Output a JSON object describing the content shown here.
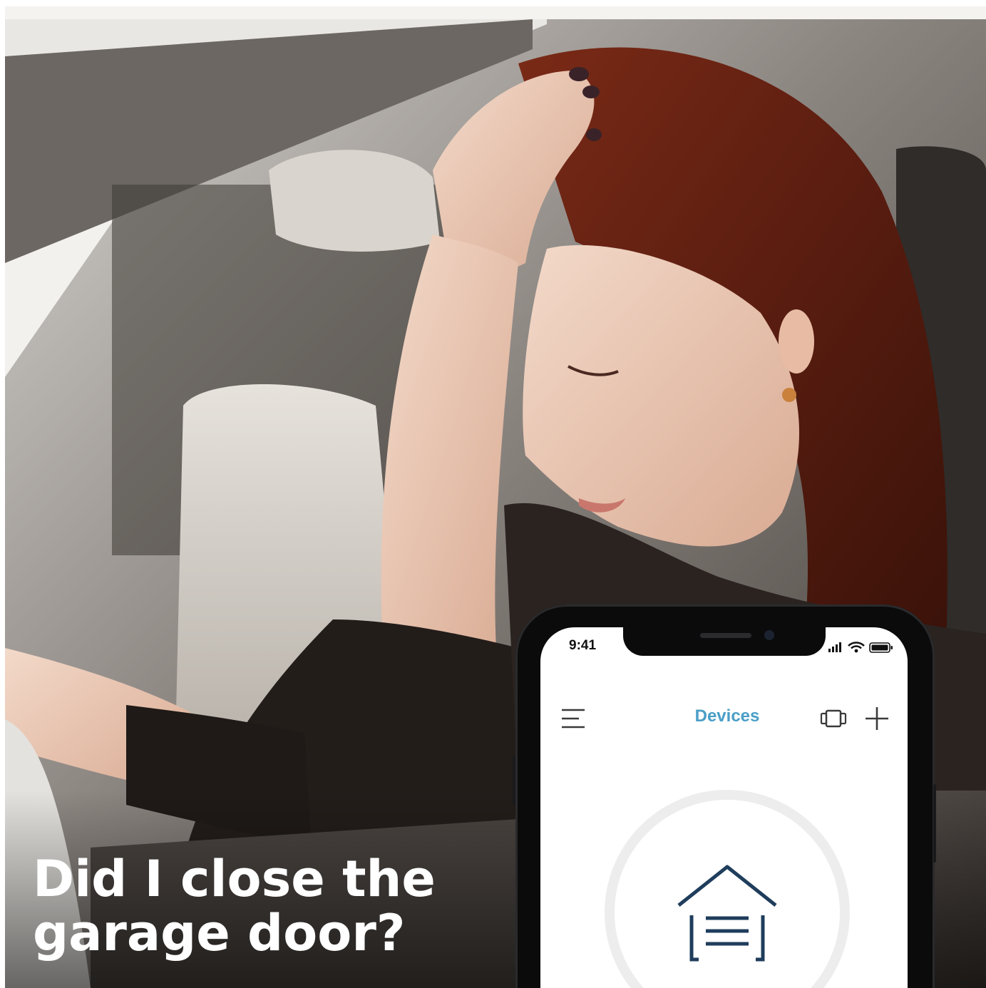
{
  "headline": {
    "line1": "Did I close the",
    "line2": "garage door?"
  },
  "phone": {
    "status_bar": {
      "time": "9:41",
      "icons": [
        "cellular-signal-icon",
        "wifi-icon",
        "battery-icon"
      ]
    },
    "nav": {
      "menu_icon": "hamburger-menu-icon",
      "title": "Devices",
      "view_icon": "card-view-icon",
      "add_icon": "plus-icon"
    },
    "device": {
      "icon": "garage-door-icon"
    }
  },
  "colors": {
    "accent": "#4a9ec7",
    "icon_navy": "#1f3d5c",
    "headline_text": "#ffffff",
    "phone_body": "#0b0b0c"
  }
}
